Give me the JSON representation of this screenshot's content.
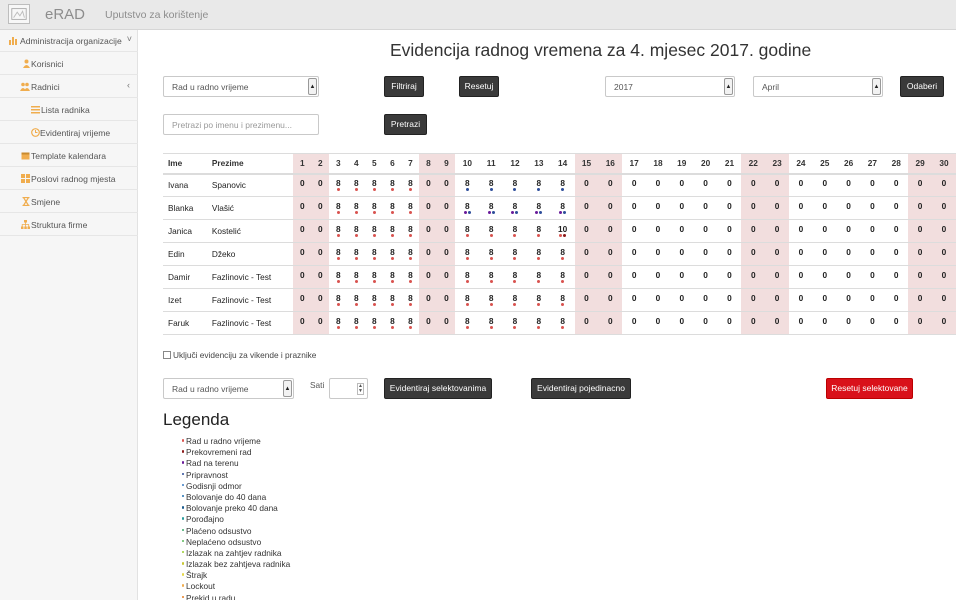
{
  "app": {
    "brand": "eRAD",
    "help_link": "Uputstvo za korištenje"
  },
  "sidebar": {
    "items": [
      {
        "label": "Administracija organizacije",
        "icon": "bar-chart-icon",
        "chevron": "˅"
      },
      {
        "label": "Korisnici",
        "icon": "user-icon"
      },
      {
        "label": "Radnici",
        "icon": "users-icon",
        "chevron": "‹"
      },
      {
        "label": "Lista radnika",
        "icon": "list-icon"
      },
      {
        "label": "Evidentiraj vrijeme",
        "icon": "clock-icon"
      },
      {
        "label": "Template kalendara",
        "icon": "calendar-icon"
      },
      {
        "label": "Poslovi radnog mjesta",
        "icon": "grid-icon"
      },
      {
        "label": "Smjene",
        "icon": "hourglass-icon"
      },
      {
        "label": "Struktura firme",
        "icon": "sitemap-icon"
      }
    ]
  },
  "page_title": "Evidencija radnog vremena za 4. mjesec 2017. godine",
  "filter": {
    "type_select": "Rad u radno vrijeme",
    "filter_button": "Filtriraj",
    "reset_button": "Resetuj",
    "year_select": "2017",
    "month_select": "April",
    "choose_button": "Odaberi",
    "search_placeholder": "Pretrazi po imenu i prezimenu...",
    "search_button": "Pretrazi"
  },
  "table": {
    "col_first": "Ime",
    "col_last": "Prezime",
    "weekend_days": [
      1,
      2,
      8,
      9,
      15,
      16,
      22,
      23,
      29,
      30
    ],
    "rows": [
      {
        "first": "Ivana",
        "last": "Spanovic",
        "values": [
          "0",
          "0",
          "8",
          "8",
          "8",
          "8",
          "8",
          "0",
          "0",
          "8",
          "8",
          "8",
          "8",
          "8",
          "0",
          "0",
          "0",
          "0",
          "0",
          "0",
          "0",
          "0",
          "0",
          "0",
          "0",
          "0",
          "0",
          "0",
          "0",
          "0"
        ],
        "dots": {
          "3": [
            "#d9534f"
          ],
          "4": [
            "#d9534f"
          ],
          "5": [
            "#d9534f"
          ],
          "6": [
            "#d9534f"
          ],
          "7": [
            "#d9534f"
          ],
          "10": [
            "#2d4d9a"
          ],
          "11": [
            "#2d4d9a"
          ],
          "12": [
            "#2d4d9a"
          ],
          "13": [
            "#2d4d9a"
          ],
          "14": [
            "#2d4d9a"
          ]
        }
      },
      {
        "first": "Blanka",
        "last": "Vlašić",
        "values": [
          "0",
          "0",
          "8",
          "8",
          "8",
          "8",
          "8",
          "0",
          "0",
          "8",
          "8",
          "8",
          "8",
          "8",
          "0",
          "0",
          "0",
          "0",
          "0",
          "0",
          "0",
          "0",
          "0",
          "0",
          "0",
          "0",
          "0",
          "0",
          "0",
          "0"
        ],
        "dots": {
          "3": [
            "#d9534f"
          ],
          "4": [
            "#d9534f"
          ],
          "5": [
            "#d9534f"
          ],
          "6": [
            "#d9534f"
          ],
          "7": [
            "#d9534f"
          ],
          "10": [
            "#6a1b9a",
            "#2d4d9a"
          ],
          "11": [
            "#6a1b9a",
            "#2d4d9a"
          ],
          "12": [
            "#6a1b9a",
            "#2d4d9a"
          ],
          "13": [
            "#6a1b9a",
            "#2d4d9a"
          ],
          "14": [
            "#6a1b9a",
            "#2d4d9a"
          ]
        }
      },
      {
        "first": "Janica",
        "last": "Kostelić",
        "values": [
          "0",
          "0",
          "8",
          "8",
          "8",
          "8",
          "8",
          "0",
          "0",
          "8",
          "8",
          "8",
          "8",
          "10",
          "0",
          "0",
          "0",
          "0",
          "0",
          "0",
          "0",
          "0",
          "0",
          "0",
          "0",
          "0",
          "0",
          "0",
          "0",
          "0"
        ],
        "dots": {
          "3": [
            "#d9534f"
          ],
          "4": [
            "#d9534f"
          ],
          "5": [
            "#d9534f"
          ],
          "6": [
            "#d9534f"
          ],
          "7": [
            "#d9534f"
          ],
          "10": [
            "#d9534f"
          ],
          "11": [
            "#d9534f"
          ],
          "12": [
            "#d9534f"
          ],
          "13": [
            "#d9534f"
          ],
          "14": [
            "#d9534f",
            "#8b1a1a"
          ]
        }
      },
      {
        "first": "Edin",
        "last": "Džeko",
        "values": [
          "0",
          "0",
          "8",
          "8",
          "8",
          "8",
          "8",
          "0",
          "0",
          "8",
          "8",
          "8",
          "8",
          "8",
          "0",
          "0",
          "0",
          "0",
          "0",
          "0",
          "0",
          "0",
          "0",
          "0",
          "0",
          "0",
          "0",
          "0",
          "0",
          "0"
        ],
        "dots": {
          "3": [
            "#d9534f"
          ],
          "4": [
            "#d9534f"
          ],
          "5": [
            "#d9534f"
          ],
          "6": [
            "#d9534f"
          ],
          "7": [
            "#d9534f"
          ],
          "10": [
            "#d9534f"
          ],
          "11": [
            "#d9534f"
          ],
          "12": [
            "#d9534f"
          ],
          "13": [
            "#d9534f"
          ],
          "14": [
            "#d9534f"
          ]
        }
      },
      {
        "first": "Damir",
        "last": "Fazlinovic - Test",
        "values": [
          "0",
          "0",
          "8",
          "8",
          "8",
          "8",
          "8",
          "0",
          "0",
          "8",
          "8",
          "8",
          "8",
          "8",
          "0",
          "0",
          "0",
          "0",
          "0",
          "0",
          "0",
          "0",
          "0",
          "0",
          "0",
          "0",
          "0",
          "0",
          "0",
          "0"
        ],
        "dots": {
          "3": [
            "#d9534f"
          ],
          "4": [
            "#d9534f"
          ],
          "5": [
            "#d9534f"
          ],
          "6": [
            "#d9534f"
          ],
          "7": [
            "#d9534f"
          ],
          "10": [
            "#d9534f"
          ],
          "11": [
            "#d9534f"
          ],
          "12": [
            "#d9534f"
          ],
          "13": [
            "#d9534f"
          ],
          "14": [
            "#d9534f"
          ]
        }
      },
      {
        "first": "Izet",
        "last": "Fazlinovic - Test",
        "values": [
          "0",
          "0",
          "8",
          "8",
          "8",
          "8",
          "8",
          "0",
          "0",
          "8",
          "8",
          "8",
          "8",
          "8",
          "0",
          "0",
          "0",
          "0",
          "0",
          "0",
          "0",
          "0",
          "0",
          "0",
          "0",
          "0",
          "0",
          "0",
          "0",
          "0"
        ],
        "dots": {
          "3": [
            "#d9534f"
          ],
          "4": [
            "#d9534f"
          ],
          "5": [
            "#d9534f"
          ],
          "6": [
            "#d9534f"
          ],
          "7": [
            "#d9534f"
          ],
          "10": [
            "#d9534f"
          ],
          "11": [
            "#d9534f"
          ],
          "12": [
            "#d9534f"
          ],
          "13": [
            "#d9534f"
          ],
          "14": [
            "#d9534f"
          ]
        }
      },
      {
        "first": "Faruk",
        "last": "Fazlinovic - Test",
        "values": [
          "0",
          "0",
          "8",
          "8",
          "8",
          "8",
          "8",
          "0",
          "0",
          "8",
          "8",
          "8",
          "8",
          "8",
          "0",
          "0",
          "0",
          "0",
          "0",
          "0",
          "0",
          "0",
          "0",
          "0",
          "0",
          "0",
          "0",
          "0",
          "0",
          "0"
        ],
        "dots": {
          "3": [
            "#d9534f"
          ],
          "4": [
            "#d9534f"
          ],
          "5": [
            "#d9534f"
          ],
          "6": [
            "#d9534f"
          ],
          "7": [
            "#d9534f"
          ],
          "10": [
            "#d9534f"
          ],
          "11": [
            "#d9534f"
          ],
          "12": [
            "#d9534f"
          ],
          "13": [
            "#d9534f"
          ],
          "14": [
            "#d9534f"
          ]
        }
      }
    ]
  },
  "weekend_checkbox_label": "Uključi evidenciju za vikende i praznike",
  "bulk": {
    "type_select": "Rad u radno vrijeme",
    "hours_label": "Sati",
    "hours_value": "",
    "evid_selected_button": "Evidentiraj selektovanima",
    "evid_single_button": "Evidentiraj pojedinacno",
    "reset_selected_button": "Resetuj selektovane"
  },
  "legend": {
    "title": "Legenda",
    "items": [
      {
        "label": "Rad u radno vrijeme",
        "color": "#d9534f"
      },
      {
        "label": "Prekovremeni rad",
        "color": "#8b1a1a"
      },
      {
        "label": "Rad na terenu",
        "color": "#6a1b9a"
      },
      {
        "label": "Pripravnost",
        "color": "#2d4d9a"
      },
      {
        "label": "Godisnji odmor",
        "color": "#3b7dc4"
      },
      {
        "label": "Bolovanje do 40 dana",
        "color": "#1f6fb2"
      },
      {
        "label": "Bolovanje preko 40 dana",
        "color": "#1a5c8f"
      },
      {
        "label": "Porođajno",
        "color": "#2a9d9d"
      },
      {
        "label": "Plaćeno odsustvo",
        "color": "#3aa86b"
      },
      {
        "label": "Neplaćeno odsustvo",
        "color": "#5cb85c"
      },
      {
        "label": "Izlazak na zahtjev radnika",
        "color": "#9acd32"
      },
      {
        "label": "Izlazak bez zahtjeva radnika",
        "color": "#c8c832"
      },
      {
        "label": "Štrajk",
        "color": "#e6d84a"
      },
      {
        "label": "Lockout",
        "color": "#f0ad4e"
      },
      {
        "label": "Prekid u radu",
        "color": "#e67e22"
      }
    ]
  }
}
